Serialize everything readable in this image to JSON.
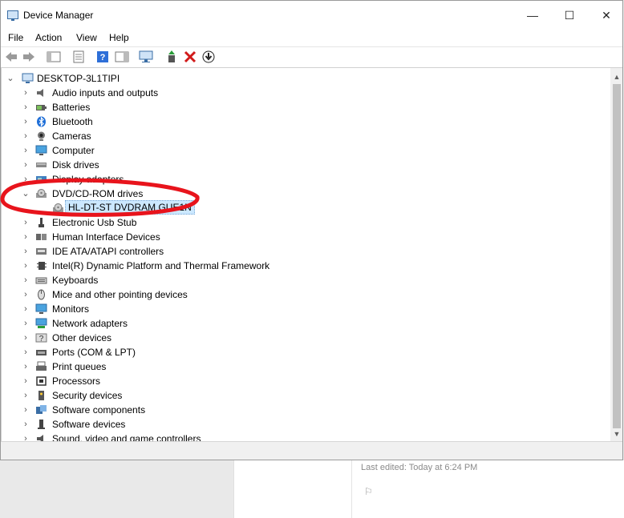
{
  "window": {
    "title": "Device Manager",
    "minimize": "—",
    "maximize": "☐",
    "close": "✕"
  },
  "menu": [
    "File",
    "Action",
    "View",
    "Help"
  ],
  "tree": {
    "root": "DESKTOP-3L1TIPI",
    "items": [
      {
        "label": "Audio inputs and outputs",
        "icon": "speaker-icon",
        "expanded": false
      },
      {
        "label": "Batteries",
        "icon": "battery-icon",
        "expanded": false
      },
      {
        "label": "Bluetooth",
        "icon": "bluetooth-icon",
        "expanded": false
      },
      {
        "label": "Cameras",
        "icon": "camera-icon",
        "expanded": false
      },
      {
        "label": "Computer",
        "icon": "monitor-icon",
        "expanded": false
      },
      {
        "label": "Disk drives",
        "icon": "disk-drive-icon",
        "expanded": false
      },
      {
        "label": "Display adapters",
        "icon": "display-adapter-icon",
        "expanded": false
      },
      {
        "label": "DVD/CD-ROM drives",
        "icon": "optical-drive-icon",
        "expanded": true,
        "children": [
          {
            "label": "HL-DT-ST DVDRAM GUE1N",
            "icon": "optical-drive-icon",
            "selected": true
          }
        ]
      },
      {
        "label": "Electronic Usb Stub",
        "icon": "usb-icon",
        "expanded": false
      },
      {
        "label": "Human Interface Devices",
        "icon": "hid-icon",
        "expanded": false
      },
      {
        "label": "IDE ATA/ATAPI controllers",
        "icon": "ide-controller-icon",
        "expanded": false
      },
      {
        "label": "Intel(R) Dynamic Platform and Thermal Framework",
        "icon": "chip-icon",
        "expanded": false
      },
      {
        "label": "Keyboards",
        "icon": "keyboard-icon",
        "expanded": false
      },
      {
        "label": "Mice and other pointing devices",
        "icon": "mouse-icon",
        "expanded": false
      },
      {
        "label": "Monitors",
        "icon": "monitor-icon",
        "expanded": false
      },
      {
        "label": "Network adapters",
        "icon": "network-icon",
        "expanded": false
      },
      {
        "label": "Other devices",
        "icon": "unknown-device-icon",
        "expanded": false
      },
      {
        "label": "Ports (COM & LPT)",
        "icon": "port-icon",
        "expanded": false
      },
      {
        "label": "Print queues",
        "icon": "printer-icon",
        "expanded": false
      },
      {
        "label": "Processors",
        "icon": "processor-icon",
        "expanded": false
      },
      {
        "label": "Security devices",
        "icon": "security-icon",
        "expanded": false
      },
      {
        "label": "Software components",
        "icon": "software-component-icon",
        "expanded": false
      },
      {
        "label": "Software devices",
        "icon": "software-device-icon",
        "expanded": false
      },
      {
        "label": "Sound, video and game controllers",
        "icon": "sound-icon",
        "expanded": false
      }
    ]
  },
  "background": {
    "last_edited": "Last edited: Today at 6:24 PM"
  },
  "colors": {
    "selection": "#cce8ff",
    "annotation": "#e8141c",
    "delete": "#d11a1a",
    "help": "#2e6fd8"
  }
}
